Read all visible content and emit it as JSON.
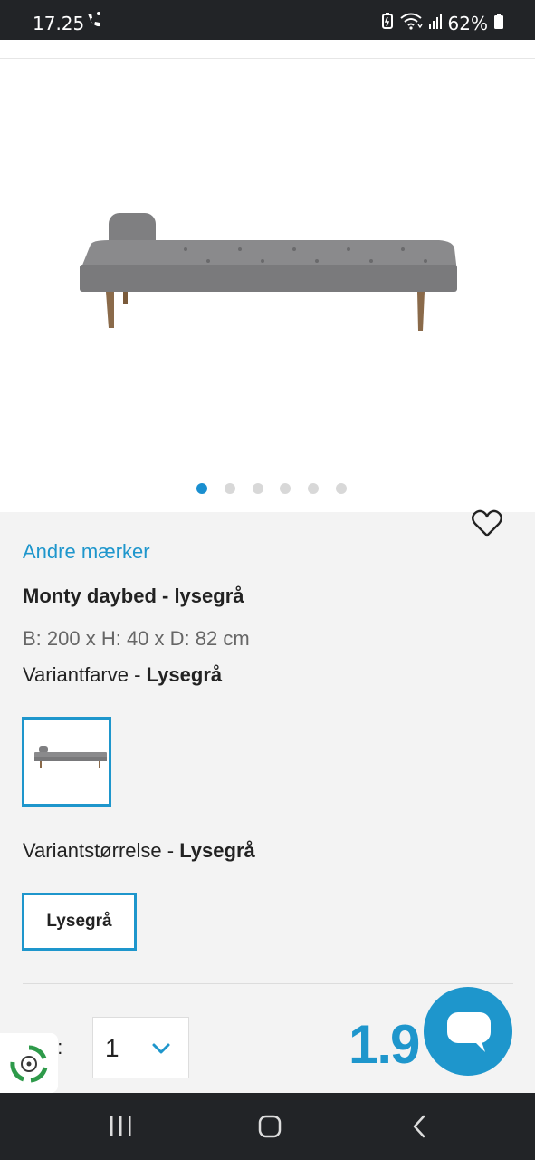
{
  "status_bar": {
    "time": "17.25",
    "battery": "62%",
    "icons": [
      "missed-call-icon",
      "battery-saver-icon",
      "wifi-icon",
      "signal-icon",
      "battery-icon"
    ]
  },
  "product": {
    "brand_link": "Andre mærker",
    "title": "Monty daybed - lysegrå",
    "dimensions": "B: 200 x H: 40 x D: 82 cm",
    "variant_color_label": "Variantfarve - ",
    "variant_color_value": "Lysegrå",
    "variant_size_label": "Variantstørrelse - ",
    "variant_size_value": "Lysegrå",
    "size_option": "Lysegrå",
    "quantity_label": "Antal:",
    "quantity_label_visible": "tal:",
    "quantity_value": "1",
    "price_visible": "1.9"
  },
  "gallery": {
    "image_count": 6,
    "active_index": 0
  },
  "colors": {
    "accent": "#1e96cc",
    "dot_inactive": "#d8d8d8",
    "status_bar": "#222427"
  }
}
